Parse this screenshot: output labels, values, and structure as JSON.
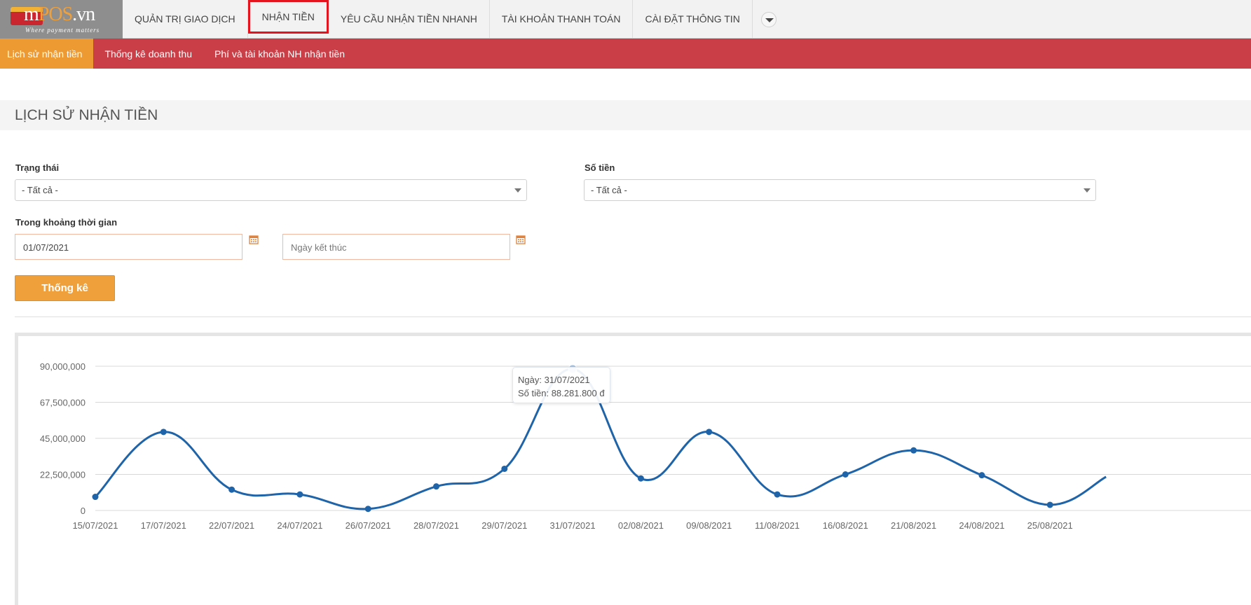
{
  "logo": {
    "brand_m": "m",
    "brand_p": "P",
    "brand_o": "O",
    "brand_s": "S",
    "brand_tld": ".vn",
    "tagline": "Where payment matters"
  },
  "topnav": {
    "items": [
      {
        "label": "QUẢN TRỊ GIAO DỊCH"
      },
      {
        "label": "NHẬN TIỀN",
        "active": true
      },
      {
        "label": "YÊU CẦU NHẬN TIỀN NHANH"
      },
      {
        "label": "TÀI KHOẢN THANH TOÁN"
      },
      {
        "label": "CÀI ĐẶT THÔNG TIN"
      }
    ],
    "more_icon": "chevron-down-icon"
  },
  "subnav": {
    "items": [
      {
        "label": "Lịch sử nhận tiền",
        "active": true
      },
      {
        "label": "Thống kê doanh thu"
      },
      {
        "label": "Phí và tài khoản NH nhận tiền"
      }
    ]
  },
  "page": {
    "title": "LỊCH SỬ NHẬN TIỀN"
  },
  "form": {
    "status_label": "Trạng thái",
    "status_value": "- Tất cả -",
    "amount_label": "Số tiền",
    "amount_value": "- Tất cả -",
    "range_label": "Trong khoảng thời gian",
    "start_date_value": "01/07/2021",
    "end_date_placeholder": "Ngày kết thúc",
    "calendar_icon": "calendar-icon",
    "submit_label": "Thống kê"
  },
  "colors": {
    "nav_red": "#c93e47",
    "accent_orange": "#f0a03a",
    "series_blue": "#1f64a8",
    "active_border": "#e3141d"
  },
  "chart_data": {
    "type": "line",
    "categories": [
      "15/07/2021",
      "17/07/2021",
      "22/07/2021",
      "24/07/2021",
      "26/07/2021",
      "28/07/2021",
      "29/07/2021",
      "31/07/2021",
      "02/08/2021",
      "09/08/2021",
      "11/08/2021",
      "16/08/2021",
      "21/08/2021",
      "24/08/2021",
      "25/08/2021"
    ],
    "values": [
      8500000,
      49000000,
      13000000,
      10000000,
      1000000,
      15000000,
      26000000,
      88281800,
      20000000,
      49000000,
      10000000,
      22500000,
      37500000,
      22000000,
      3500000
    ],
    "yticks": [
      "0",
      "22,500,000",
      "45,000,000",
      "67,500,000",
      "90,000,000"
    ],
    "ylim": [
      0,
      90000000
    ],
    "grid": true,
    "legend": "none",
    "tooltip": {
      "line1": "Ngày: 31/07/2021",
      "line2": "Số tiền: 88.281.800 đ"
    }
  }
}
